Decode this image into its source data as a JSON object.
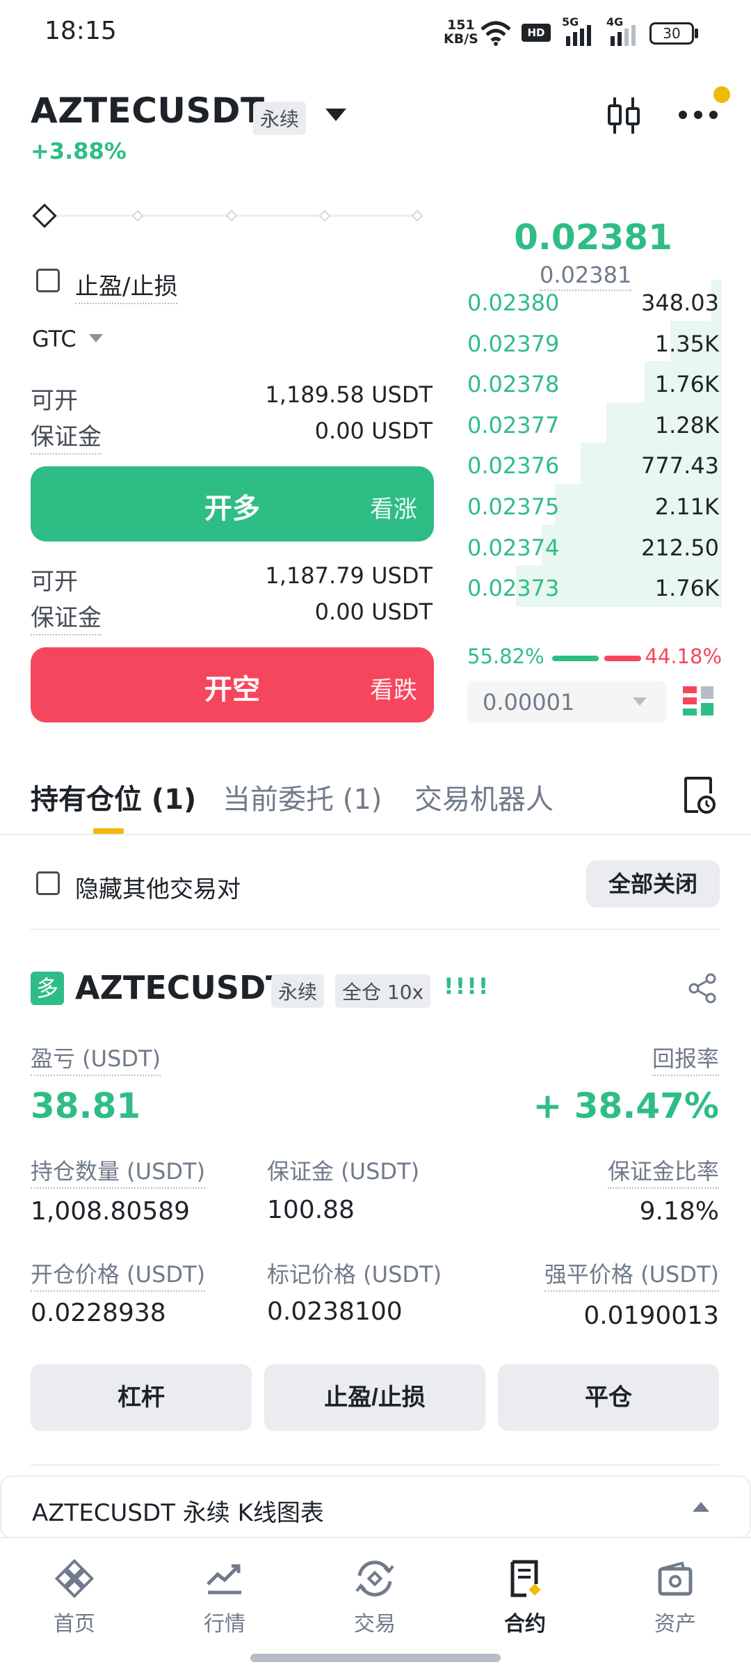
{
  "status_bar": {
    "time": "18:15",
    "net_speed_value": "151",
    "net_speed_unit": "KB/S",
    "battery": "30",
    "hd": "HD",
    "signal1": "5G",
    "signal2": "4G"
  },
  "header": {
    "symbol": "AZTECUSDT",
    "contract_type": "永续",
    "change_pct": "+3.88%"
  },
  "order_form": {
    "tpsl_label": "止盈/止损",
    "time_in_force": "GTC",
    "long": {
      "available_label": "可开",
      "available_value": "1,189.58 USDT",
      "margin_label": "保证金",
      "margin_value": "0.00 USDT",
      "button_label": "开多",
      "button_sub": "看涨"
    },
    "short": {
      "available_label": "可开",
      "available_value": "1,187.79 USDT",
      "margin_label": "保证金",
      "margin_value": "0.00 USDT",
      "button_label": "开空",
      "button_sub": "看跌"
    }
  },
  "order_book": {
    "last_price": "0.02381",
    "mark_price": "0.02381",
    "bids": [
      {
        "price": "0.02380",
        "qty": "348.03",
        "depth": 0.04
      },
      {
        "price": "0.02379",
        "qty": "1.35K",
        "depth": 0.2
      },
      {
        "price": "0.02378",
        "qty": "1.76K",
        "depth": 0.3
      },
      {
        "price": "0.02377",
        "qty": "1.28K",
        "depth": 0.45
      },
      {
        "price": "0.02376",
        "qty": "777.43",
        "depth": 0.55
      },
      {
        "price": "0.02375",
        "qty": "2.11K",
        "depth": 0.65
      },
      {
        "price": "0.02374",
        "qty": "212.50",
        "depth": 0.7
      },
      {
        "price": "0.02373",
        "qty": "1.76K",
        "depth": 0.8
      }
    ],
    "buy_ratio": "55.82%",
    "sell_ratio": "44.18%",
    "buy_ratio_value": 0.5582,
    "tick_size": "0.00001"
  },
  "tabs": {
    "positions": "持有仓位 (1)",
    "open_orders": "当前委托 (1)",
    "bots": "交易机器人"
  },
  "positions_panel": {
    "hide_others_label": "隐藏其他交易对",
    "close_all_label": "全部关闭"
  },
  "position": {
    "side_badge": "多",
    "symbol": "AZTECUSDT",
    "contract_type": "永续",
    "margin_mode": "全仓 10x",
    "risk_indicator": "!!!!",
    "pnl_label": "盈亏 (USDT)",
    "pnl_value": "38.81",
    "roe_label": "回报率",
    "roe_value": "+ 38.47%",
    "size_label": "持仓数量 (USDT)",
    "size_value": "1,008.80589",
    "margin_label": "保证金 (USDT)",
    "margin_value": "100.88",
    "margin_ratio_label": "保证金比率",
    "margin_ratio_value": "9.18%",
    "entry_label": "开仓价格 (USDT)",
    "entry_value": "0.0228938",
    "mark_label": "标记价格 (USDT)",
    "mark_value": "0.0238100",
    "liq_label": "强平价格 (USDT)",
    "liq_value": "0.0190013",
    "btn_leverage": "杠杆",
    "btn_tpsl": "止盈/止损",
    "btn_close": "平仓"
  },
  "kline_bar": {
    "title": "AZTECUSDT 永续 K线图表"
  },
  "bottom_nav": {
    "home": "首页",
    "markets": "行情",
    "trade": "交易",
    "futures": "合约",
    "assets": "资产"
  },
  "colors": {
    "green": "#2ebd85",
    "red": "#f6465d",
    "accent": "#f0b90b"
  }
}
